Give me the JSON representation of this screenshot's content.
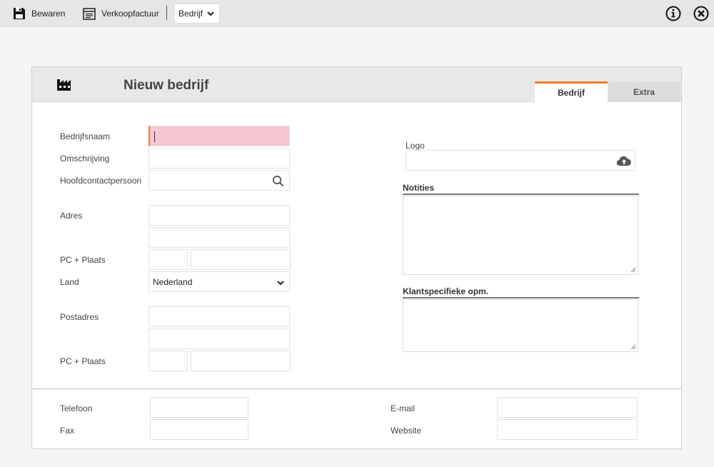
{
  "toolbar": {
    "save_label": "Bewaren",
    "invoice_label": "Verkoopfactuur",
    "type_select_value": "Bedrijf"
  },
  "card": {
    "title": "Nieuw bedrijf",
    "tabs": [
      {
        "label": "Bedrijf",
        "active": true
      },
      {
        "label": "Extra",
        "active": false
      }
    ]
  },
  "form": {
    "company_name_label": "Bedrijfsnaam",
    "description_label": "Omschrijving",
    "main_contact_label": "Hoofdcontactpersoon",
    "address_label": "Adres",
    "postal_city_label": "PC + Plaats",
    "country_label": "Land",
    "country_value": "Nederland",
    "postal_address_label": "Postadres",
    "postal_city2_label": "PC + Plaats",
    "logo_label": "Logo",
    "notes_label": "Notities",
    "client_notes_label": "Klantspecifieke opm."
  },
  "contact": {
    "phone_label": "Telefoon",
    "fax_label": "Fax",
    "email_label": "E-mail",
    "website_label": "Website"
  },
  "colors": {
    "accent": "#f07a28",
    "required_bg": "#f4c7d3",
    "toolbar_bg": "#e6e6e6"
  }
}
